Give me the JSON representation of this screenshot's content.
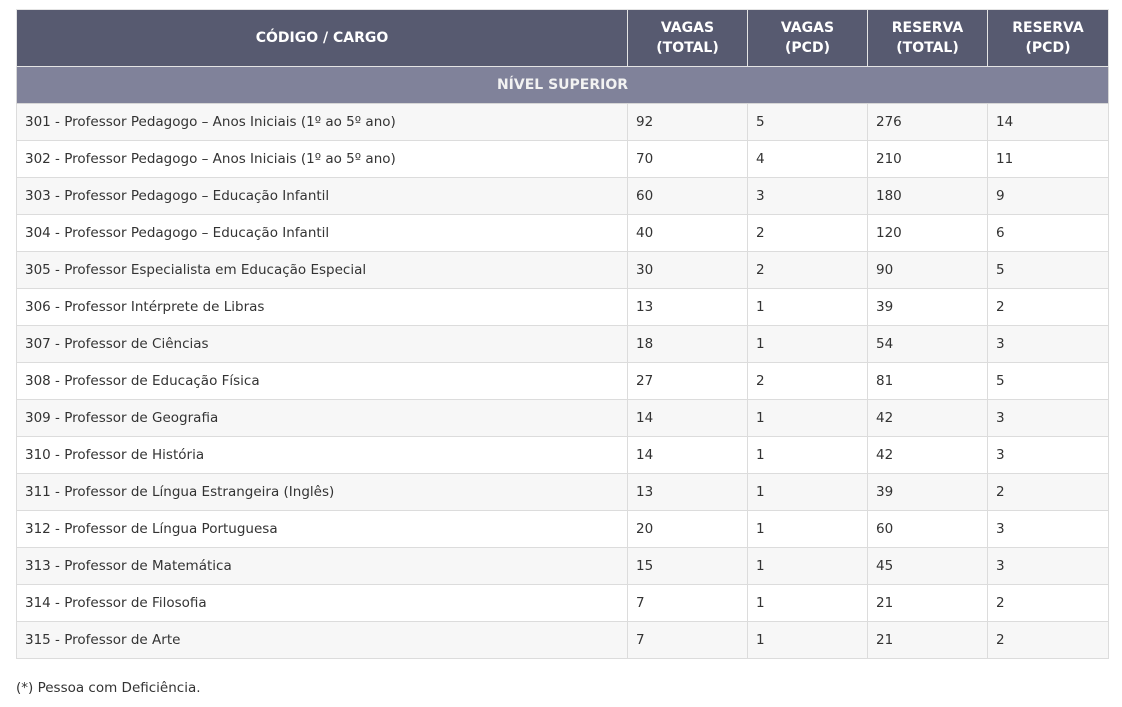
{
  "table": {
    "headers": [
      {
        "line1": "CÓDIGO / CARGO",
        "line2": ""
      },
      {
        "line1": "VAGAS",
        "line2": "(TOTAL)"
      },
      {
        "line1": "VAGAS",
        "line2": "(PCD)"
      },
      {
        "line1": "RESERVA",
        "line2": "(TOTAL)"
      },
      {
        "line1": "RESERVA",
        "line2": "(PCD)"
      }
    ],
    "section_title": "NÍVEL SUPERIOR",
    "rows": [
      {
        "cargo": "301 - Professor Pedagogo – Anos Iniciais (1º ao 5º ano)",
        "vagas_total": "92",
        "vagas_pcd": "5",
        "reserva_total": "276",
        "reserva_pcd": "14"
      },
      {
        "cargo": "302 - Professor Pedagogo – Anos Iniciais (1º ao 5º ano)",
        "vagas_total": "70",
        "vagas_pcd": "4",
        "reserva_total": "210",
        "reserva_pcd": "11"
      },
      {
        "cargo": "303 - Professor Pedagogo – Educação Infantil",
        "vagas_total": "60",
        "vagas_pcd": "3",
        "reserva_total": "180",
        "reserva_pcd": "9"
      },
      {
        "cargo": "304 - Professor Pedagogo – Educação Infantil",
        "vagas_total": "40",
        "vagas_pcd": "2",
        "reserva_total": "120",
        "reserva_pcd": "6"
      },
      {
        "cargo": "305 - Professor Especialista em Educação Especial",
        "vagas_total": "30",
        "vagas_pcd": "2",
        "reserva_total": "90",
        "reserva_pcd": "5"
      },
      {
        "cargo": "306 - Professor Intérprete de Libras",
        "vagas_total": "13",
        "vagas_pcd": "1",
        "reserva_total": "39",
        "reserva_pcd": "2"
      },
      {
        "cargo": "307 - Professor de Ciências",
        "vagas_total": "18",
        "vagas_pcd": "1",
        "reserva_total": "54",
        "reserva_pcd": "3"
      },
      {
        "cargo": "308 - Professor de Educação Física",
        "vagas_total": "27",
        "vagas_pcd": "2",
        "reserva_total": "81",
        "reserva_pcd": "5"
      },
      {
        "cargo": "309 - Professor de Geografia",
        "vagas_total": "14",
        "vagas_pcd": "1",
        "reserva_total": "42",
        "reserva_pcd": "3"
      },
      {
        "cargo": "310 - Professor de História",
        "vagas_total": "14",
        "vagas_pcd": "1",
        "reserva_total": "42",
        "reserva_pcd": "3"
      },
      {
        "cargo": "311 - Professor de Língua Estrangeira (Inglês)",
        "vagas_total": "13",
        "vagas_pcd": "1",
        "reserva_total": "39",
        "reserva_pcd": "2"
      },
      {
        "cargo": "312 - Professor de Língua Portuguesa",
        "vagas_total": "20",
        "vagas_pcd": "1",
        "reserva_total": "60",
        "reserva_pcd": "3"
      },
      {
        "cargo": "313 - Professor de Matemática",
        "vagas_total": "15",
        "vagas_pcd": "1",
        "reserva_total": "45",
        "reserva_pcd": "3"
      },
      {
        "cargo": "314 - Professor de Filosofia",
        "vagas_total": "7",
        "vagas_pcd": "1",
        "reserva_total": "21",
        "reserva_pcd": "2"
      },
      {
        "cargo": "315 - Professor de Arte",
        "vagas_total": "7",
        "vagas_pcd": "1",
        "reserva_total": "21",
        "reserva_pcd": "2"
      }
    ]
  },
  "footnote": "(*) Pessoa com Deficiência.",
  "colors": {
    "header_bg": "#575a70",
    "section_bg": "#80829a",
    "row_alt_bg": "#f7f7f7",
    "border": "#dcdcdc"
  }
}
